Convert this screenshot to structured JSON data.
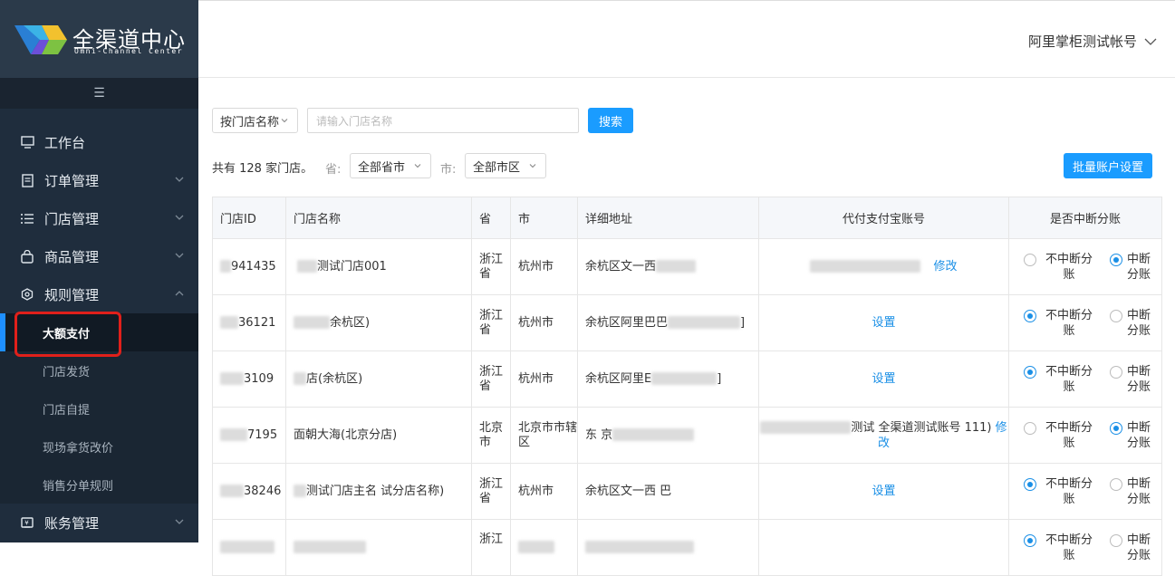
{
  "brand": {
    "title": "全渠道中心",
    "subtitle": "Omni-Channel Center"
  },
  "header": {
    "account": "阿里掌柜测试帐号"
  },
  "sidebar": {
    "collapse": "☰",
    "items": [
      {
        "label": "工作台",
        "icon": "monitor-icon"
      },
      {
        "label": "订单管理",
        "icon": "document-icon"
      },
      {
        "label": "门店管理",
        "icon": "list-icon"
      },
      {
        "label": "商品管理",
        "icon": "bag-icon"
      },
      {
        "label": "规则管理",
        "icon": "settings-icon"
      },
      {
        "label": "账务管理",
        "icon": "wallet-icon"
      }
    ],
    "sub_items": [
      "大额支付",
      "门店发货",
      "门店自提",
      "现场拿货改价",
      "销售分单规则"
    ],
    "active_sub": "大额支付"
  },
  "filters": {
    "search_type": "按门店名称",
    "search_placeholder": "请输入门店名称",
    "search_button": "搜索",
    "total_text": "共有 128 家门店。",
    "province_label": "省:",
    "province_value": "全部省市",
    "city_label": "市:",
    "city_value": "全部市区",
    "batch_button": "批量账户设置"
  },
  "table": {
    "headers": [
      "门店ID",
      "门店名称",
      "省",
      "市",
      "详细地址",
      "代付支付宝账号",
      "是否中断分账"
    ],
    "radio_labels": {
      "no_interrupt": "不中断分账",
      "interrupt": "中断分账"
    },
    "rows": [
      {
        "id": "941435",
        "name": "测试门店001",
        "province": "浙江省",
        "city": "杭州市",
        "address": "余杭区文一西",
        "account_action": "修改",
        "interrupt": true
      },
      {
        "id": "36121",
        "name": "余杭区)",
        "province": "浙江省",
        "city": "杭州市",
        "address": "余杭区阿里巴巴",
        "account_action": "设置",
        "interrupt": false
      },
      {
        "id": "3109",
        "name": "店(余杭区)",
        "province": "浙江省",
        "city": "杭州市",
        "address": "余杭区阿里E",
        "account_action": "设置",
        "interrupt": false
      },
      {
        "id": "7195",
        "name": "面朝大海(北京分店)",
        "province": "北京市",
        "city": "北京市市辖区",
        "address": "东 京",
        "account_text": "测试 全渠道测试账号 111)",
        "account_action": "修改",
        "interrupt": true
      },
      {
        "id": "38246",
        "name": "测试门店主名 试分店名称)",
        "province": "浙江省",
        "city": "杭州市",
        "address": "余杭区文一西 巴",
        "account_action": "设置",
        "interrupt": false
      },
      {
        "id": "",
        "name": "",
        "province": "浙江",
        "city": "",
        "address": "",
        "account_action": "",
        "interrupt": false
      }
    ]
  },
  "colors": {
    "accent": "#1a9cff",
    "sidebar": "#1f2d3d",
    "highlight": "#e0201b"
  }
}
